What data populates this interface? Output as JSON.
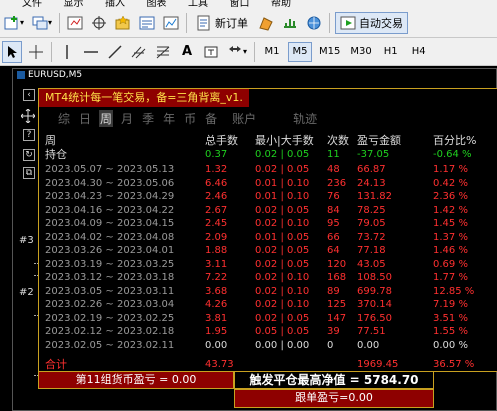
{
  "menu": [
    "文件",
    "显示",
    "插入",
    "图表",
    "工具",
    "窗口",
    "帮助"
  ],
  "toolbar1": {
    "new_order": "新订单",
    "auto_trade": "自动交易"
  },
  "toolbar2": {
    "text_tool": "A",
    "timeframes": [
      "M1",
      "M5",
      "M15",
      "M30",
      "H1",
      "H4"
    ],
    "active_timeframe": "M5"
  },
  "chart": {
    "symbol": "EURUSD,M5",
    "side_labels": [
      "#3",
      "#2"
    ]
  },
  "panel": {
    "title": "MT4统计每一笔交易，备=三角背离_v1.",
    "periods": [
      "综",
      "日",
      "周",
      "月",
      "季",
      "年",
      "币",
      "备",
      "账户",
      "轨迹"
    ],
    "active_period": "周",
    "headers": [
      "周",
      "总手数",
      "最小|大手数",
      "次数",
      "盈亏金额",
      "百分比%",
      "#"
    ],
    "position": {
      "label": "持仓",
      "lots": "0.37",
      "minmax": "0.02 | 0.05",
      "count": "11",
      "pnl": "-37.05",
      "pct": "-0.64 %"
    },
    "rows": [
      {
        "period": "2023.05.07 ~ 2023.05.13",
        "lots": "1.32",
        "minmax": "0.02 | 0.05",
        "count": "48",
        "pnl": "66.87",
        "pct": "1.17 %",
        "lots_color": "#ff3030",
        "pnl_color": "#ff3030",
        "pct_color": "#ff3030"
      },
      {
        "period": "2023.04.30 ~ 2023.05.06",
        "lots": "6.46",
        "minmax": "0.01 | 0.10",
        "count": "236",
        "pnl": "24.13",
        "pct": "0.42 %",
        "lots_color": "#ff3030",
        "pnl_color": "#ff3030",
        "pct_color": "#ff3030"
      },
      {
        "period": "2023.04.23 ~ 2023.04.29",
        "lots": "2.46",
        "minmax": "0.01 | 0.10",
        "count": "76",
        "pnl": "131.82",
        "pct": "2.36 %",
        "lots_color": "#ff3030",
        "pnl_color": "#ff3030",
        "pct_color": "#ff3030"
      },
      {
        "period": "2023.04.16 ~ 2023.04.22",
        "lots": "2.67",
        "minmax": "0.02 | 0.05",
        "count": "84",
        "pnl": "78.25",
        "pct": "1.42 %",
        "lots_color": "#ff3030",
        "pnl_color": "#ff3030",
        "pct_color": "#ff3030"
      },
      {
        "period": "2023.04.09 ~ 2023.04.15",
        "lots": "2.45",
        "minmax": "0.02 | 0.10",
        "count": "95",
        "pnl": "79.05",
        "pct": "1.45 %",
        "lots_color": "#ff3030",
        "pnl_color": "#ff3030",
        "pct_color": "#ff3030"
      },
      {
        "period": "2023.04.02 ~ 2023.04.08",
        "lots": "2.09",
        "minmax": "0.01 | 0.05",
        "count": "66",
        "pnl": "73.72",
        "pct": "1.37 %",
        "lots_color": "#ff3030",
        "pnl_color": "#ff3030",
        "pct_color": "#ff3030"
      },
      {
        "period": "2023.03.26 ~ 2023.04.01",
        "lots": "1.88",
        "minmax": "0.02 | 0.05",
        "count": "64",
        "pnl": "77.18",
        "pct": "1.46 %",
        "lots_color": "#ff3030",
        "pnl_color": "#ff3030",
        "pct_color": "#ff3030"
      },
      {
        "period": "2023.03.19 ~ 2023.03.25",
        "lots": "3.11",
        "minmax": "0.02 | 0.05",
        "count": "120",
        "pnl": "43.05",
        "pct": "0.69 %",
        "lots_color": "#ff3030",
        "pnl_color": "#ff3030",
        "pct_color": "#ff3030"
      },
      {
        "period": "2023.03.12 ~ 2023.03.18",
        "lots": "7.22",
        "minmax": "0.02 | 0.10",
        "count": "168",
        "pnl": "108.50",
        "pct": "1.77 %",
        "lots_color": "#ff3030",
        "pnl_color": "#ff3030",
        "pct_color": "#ff3030"
      },
      {
        "period": "2023.03.05 ~ 2023.03.11",
        "lots": "3.68",
        "minmax": "0.02 | 0.10",
        "count": "89",
        "pnl": "699.78",
        "pct": "12.85 %",
        "lots_color": "#ff3030",
        "pnl_color": "#ff3030",
        "pct_color": "#ff3030"
      },
      {
        "period": "2023.02.26 ~ 2023.03.04",
        "lots": "4.26",
        "minmax": "0.02 | 0.10",
        "count": "125",
        "pnl": "370.14",
        "pct": "7.19 %",
        "lots_color": "#ff3030",
        "pnl_color": "#ff3030",
        "pct_color": "#ff3030"
      },
      {
        "period": "2023.02.19 ~ 2023.02.25",
        "lots": "3.81",
        "minmax": "0.02 | 0.05",
        "count": "147",
        "pnl": "176.50",
        "pct": "3.51 %",
        "lots_color": "#ff3030",
        "pnl_color": "#ff3030",
        "pct_color": "#ff3030"
      },
      {
        "period": "2023.02.12 ~ 2023.02.18",
        "lots": "1.95",
        "minmax": "0.05 | 0.05",
        "count": "39",
        "pnl": "77.51",
        "pct": "1.55 %",
        "lots_color": "#ff3030",
        "pnl_color": "#ff3030",
        "pct_color": "#ff3030"
      },
      {
        "period": "2023.02.05 ~ 2023.02.11",
        "lots": "0.00",
        "minmax": "0.00 | 0.00",
        "count": "0",
        "pnl": "0.00",
        "pct": "0.00 %",
        "lots_color": "#dcdcdc",
        "pnl_color": "#dcdcdc",
        "pct_color": "#dcdcdc"
      }
    ],
    "total": {
      "label": "合计",
      "lots": "43.73",
      "pnl": "1969.45",
      "pct": "36.57 %"
    }
  },
  "bottom": {
    "left": "第11组货币盈亏 = 0.00",
    "right": "触发平仓最高净值 = 5784.70",
    "follow": "跟单盈亏=0.00"
  },
  "colors": {
    "red": "#ff3030",
    "green": "#1fd01f",
    "gold": "#c8a020",
    "title_bg": "#8e0000",
    "title_fg": "#ffe24a"
  }
}
